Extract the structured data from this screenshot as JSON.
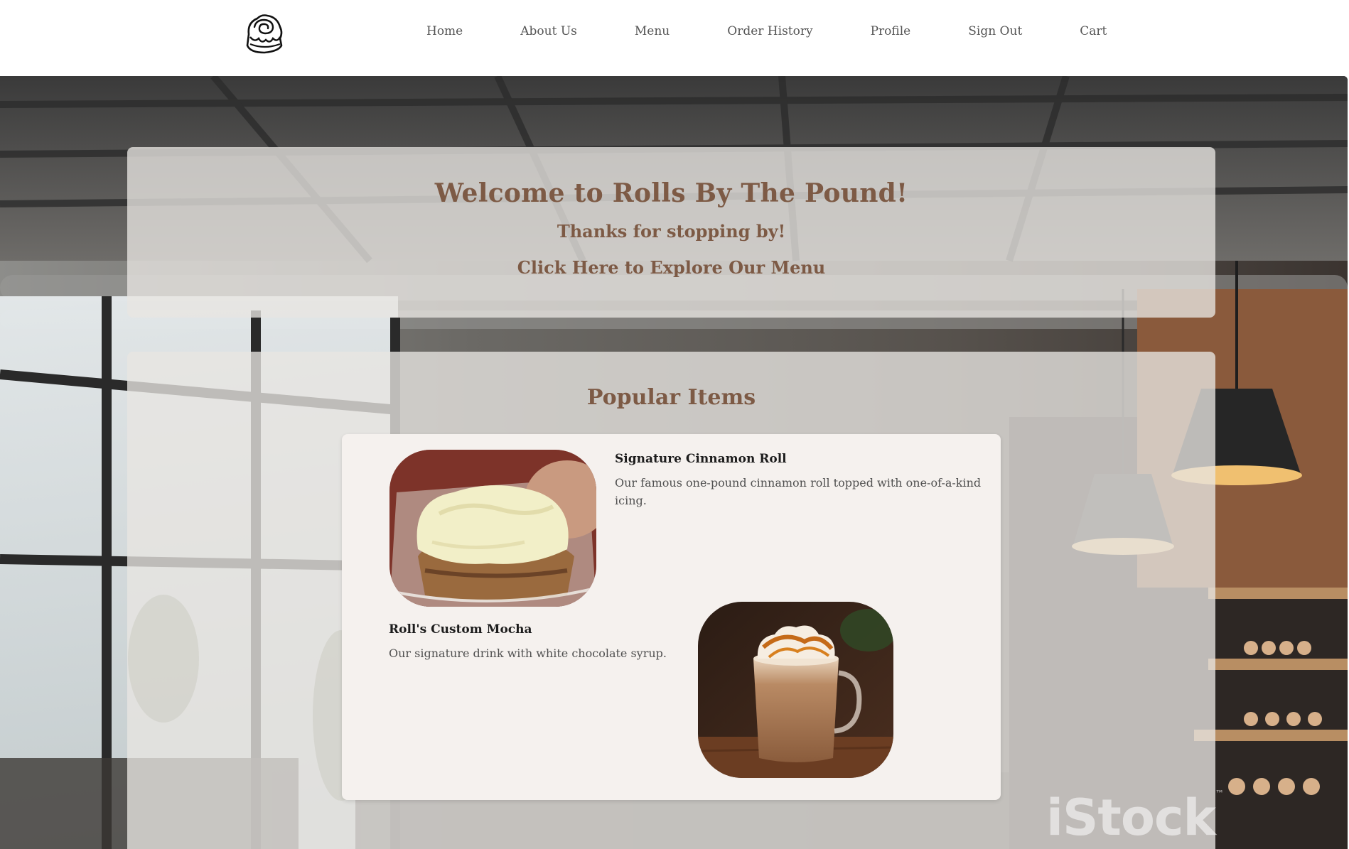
{
  "nav": {
    "logo_icon": "cinnamon-roll-icon",
    "links": [
      "Home",
      "About Us",
      "Menu",
      "Order History",
      "Profile",
      "Sign Out",
      "Cart"
    ]
  },
  "welcome": {
    "title": "Welcome to Rolls By The Pound!",
    "subtitle": "Thanks for stopping by!",
    "cta": "Click Here to Explore Our Menu"
  },
  "popular": {
    "title": "Popular Items",
    "items": [
      {
        "name": "Signature Cinnamon Roll",
        "description": "Our famous one-pound cinnamon roll topped with one-of-a-kind icing."
      },
      {
        "name": "Roll's Custom Mocha",
        "description": "Our signature drink with white chocolate syrup."
      }
    ]
  },
  "watermark": "iStock",
  "colors": {
    "accent": "#7d5a45",
    "nav_text": "#555555",
    "card_bg": "#f5f1ee"
  }
}
